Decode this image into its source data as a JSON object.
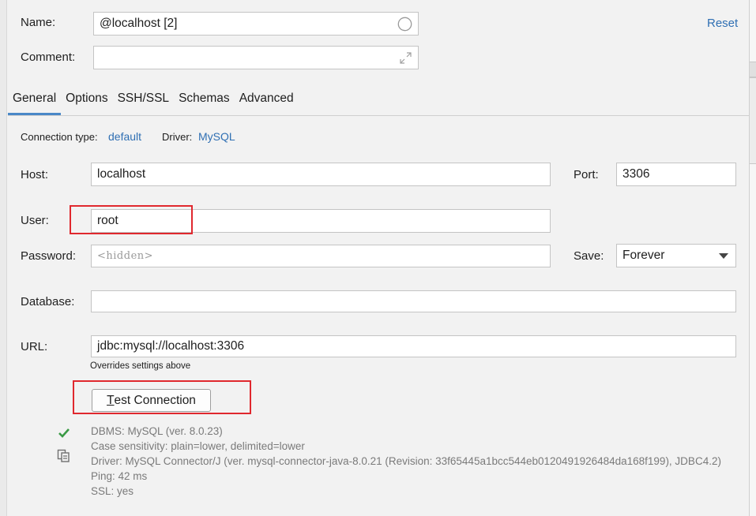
{
  "header": {
    "name_label": "Name:",
    "name_value": "@localhost [2]",
    "comment_label": "Comment:",
    "comment_value": "",
    "reset_label": "Reset"
  },
  "tabs": [
    {
      "label": "General",
      "active": true
    },
    {
      "label": "Options",
      "active": false
    },
    {
      "label": "SSH/SSL",
      "active": false
    },
    {
      "label": "Schemas",
      "active": false
    },
    {
      "label": "Advanced",
      "active": false
    }
  ],
  "connection_info": {
    "type_label": "Connection type:",
    "type_value": "default",
    "driver_label": "Driver:",
    "driver_value": "MySQL"
  },
  "form": {
    "host_label": "Host:",
    "host_value": "localhost",
    "port_label": "Port:",
    "port_value": "3306",
    "user_label": "User:",
    "user_value": "root",
    "password_label": "Password:",
    "password_placeholder": "<hidden>",
    "save_label": "Save:",
    "save_value": "Forever",
    "database_label": "Database:",
    "database_value": "",
    "url_label": "URL:",
    "url_value": "jdbc:mysql://localhost:3306",
    "url_hint": "Overrides settings above"
  },
  "test_button": {
    "mnemonic": "T",
    "rest": "est Connection"
  },
  "status": {
    "lines": [
      "DBMS: MySQL (ver. 8.0.23)",
      "Case sensitivity: plain=lower, delimited=lower",
      "Driver: MySQL Connector/J (ver. mysql-connector-java-8.0.21 (Revision: 33f65445a1bcc544eb0120491926484da168f199), JDBC4.2)",
      "Ping: 42 ms",
      "SSL: yes"
    ]
  },
  "colors": {
    "accent": "#2f6fb3",
    "highlight": "#e0282e",
    "success": "#3a9a45",
    "tab_underline": "#4a88c7"
  },
  "icons": {
    "name_field": "circle-icon",
    "comment_field": "expand-icon",
    "status_ok": "checkmark-icon",
    "copy": "copy-icon",
    "save_dropdown": "chevron-down-icon"
  }
}
